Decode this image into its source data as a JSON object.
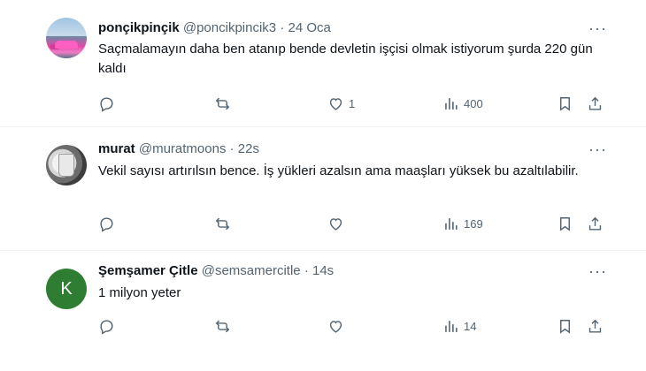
{
  "tweets": [
    {
      "display_name": "ponçikpinçik",
      "handle": "@poncikpincik3",
      "separator": "·",
      "time": "24 Oca",
      "text": "Saçmalamayın daha ben atanıp bende devletin işçisi olmak istiyorum şurda 220 gün kaldı",
      "likes": "1",
      "views": "400",
      "avatar": "pink-car-photo"
    },
    {
      "display_name": "murat",
      "handle": "@muratmoons",
      "separator": "·",
      "time": "22s",
      "text": "Vekil sayısı artırılsın bence. İş yükleri azalsın ama maaşları yüksek bu azaltılabilir.",
      "likes": "",
      "views": "169",
      "avatar": "cup-photo"
    },
    {
      "display_name": "Şemşamer Çitle",
      "handle": "@semsamercitle",
      "separator": "·",
      "time": "14s",
      "text": "1 milyon yeter",
      "likes": "",
      "views": "14",
      "avatar_letter": "K",
      "avatar_color": "#2e7d32"
    }
  ],
  "more_glyph": "···",
  "colors": {
    "text": "#0f1419",
    "secondary": "#536471",
    "divider": "#eff3f4"
  },
  "icons": [
    "reply-icon",
    "retweet-icon",
    "like-icon",
    "views-icon",
    "bookmark-icon",
    "share-icon",
    "more-icon"
  ]
}
